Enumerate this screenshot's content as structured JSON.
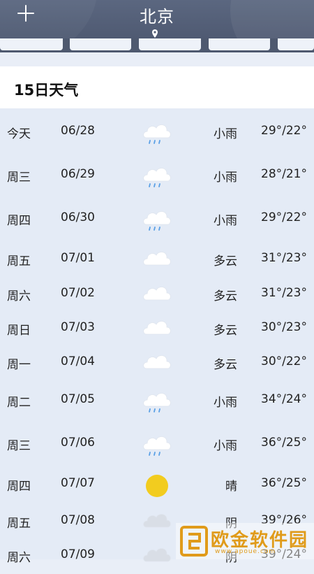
{
  "header": {
    "city": "北京",
    "add_icon": "plus-icon",
    "location_icon": "location-pin-icon"
  },
  "section": {
    "title": "15日天气"
  },
  "colors": {
    "header_bg": "#556078",
    "list_bg": "#e4ebf6",
    "cloud": "#ffffff",
    "rain": "#5aa0e6",
    "sun": "#f2cc1f",
    "overcast": "#d9dee6"
  },
  "forecast": [
    {
      "day": "今天",
      "date": "06/28",
      "icon": "light-rain-icon",
      "cond": "小雨",
      "temp": "29°/22°"
    },
    {
      "day": "周三",
      "date": "06/29",
      "icon": "light-rain-icon",
      "cond": "小雨",
      "temp": "28°/21°"
    },
    {
      "day": "周四",
      "date": "06/30",
      "icon": "light-rain-icon",
      "cond": "小雨",
      "temp": "29°/22°"
    },
    {
      "day": "周五",
      "date": "07/01",
      "icon": "cloudy-icon",
      "cond": "多云",
      "temp": "31°/23°"
    },
    {
      "day": "周六",
      "date": "07/02",
      "icon": "cloudy-icon",
      "cond": "多云",
      "temp": "31°/23°"
    },
    {
      "day": "周日",
      "date": "07/03",
      "icon": "cloudy-icon",
      "cond": "多云",
      "temp": "30°/23°"
    },
    {
      "day": "周一",
      "date": "07/04",
      "icon": "cloudy-icon",
      "cond": "多云",
      "temp": "30°/22°"
    },
    {
      "day": "周二",
      "date": "07/05",
      "icon": "light-rain-icon",
      "cond": "小雨",
      "temp": "34°/24°"
    },
    {
      "day": "周三",
      "date": "07/06",
      "icon": "light-rain-icon",
      "cond": "小雨",
      "temp": "36°/25°"
    },
    {
      "day": "周四",
      "date": "07/07",
      "icon": "sunny-icon",
      "cond": "晴",
      "temp": "36°/25°"
    },
    {
      "day": "周五",
      "date": "07/08",
      "icon": "overcast-icon",
      "cond": "阴",
      "temp": "39°/26°"
    },
    {
      "day": "周六",
      "date": "07/09",
      "icon": "overcast-icon",
      "cond": "阴",
      "temp": "39°/24°"
    }
  ],
  "watermark": {
    "text": "欧金软件园",
    "url": "www.apoue.com"
  }
}
